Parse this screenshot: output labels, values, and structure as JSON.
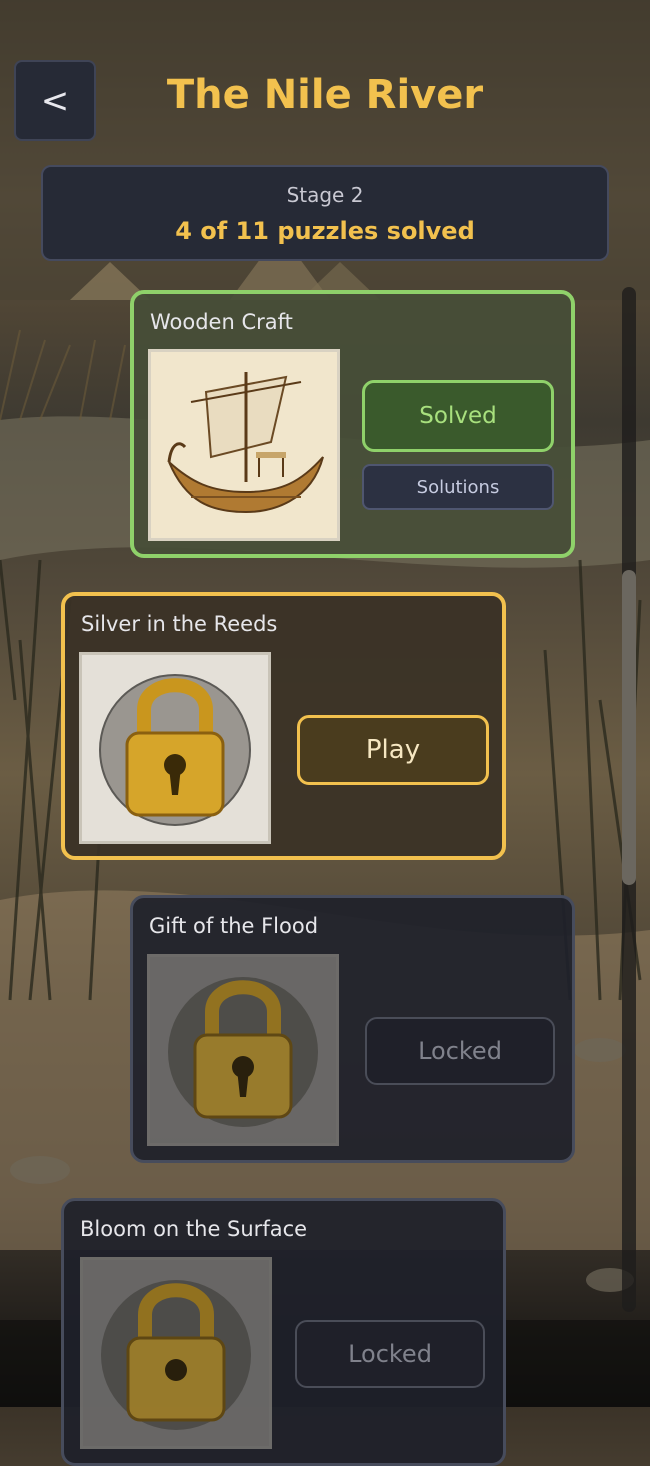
{
  "header": {
    "back_label": "<",
    "title": "The Nile River"
  },
  "stage": {
    "label": "Stage 2",
    "progress": "4 of 11 puzzles solved"
  },
  "puzzles": [
    {
      "title": "Wooden Craft",
      "status": "Solved",
      "secondary": "Solutions"
    },
    {
      "title": "Silver in the Reeds",
      "status": "Play"
    },
    {
      "title": "Gift of the Flood",
      "status": "Locked"
    },
    {
      "title": "Bloom on the Surface",
      "status": "Locked"
    }
  ],
  "colors": {
    "accent": "#f2c14e",
    "solved": "#7bc25a",
    "panel": "#262a36"
  },
  "icons": [
    "back-icon",
    "boat-image",
    "padlock-icon"
  ]
}
